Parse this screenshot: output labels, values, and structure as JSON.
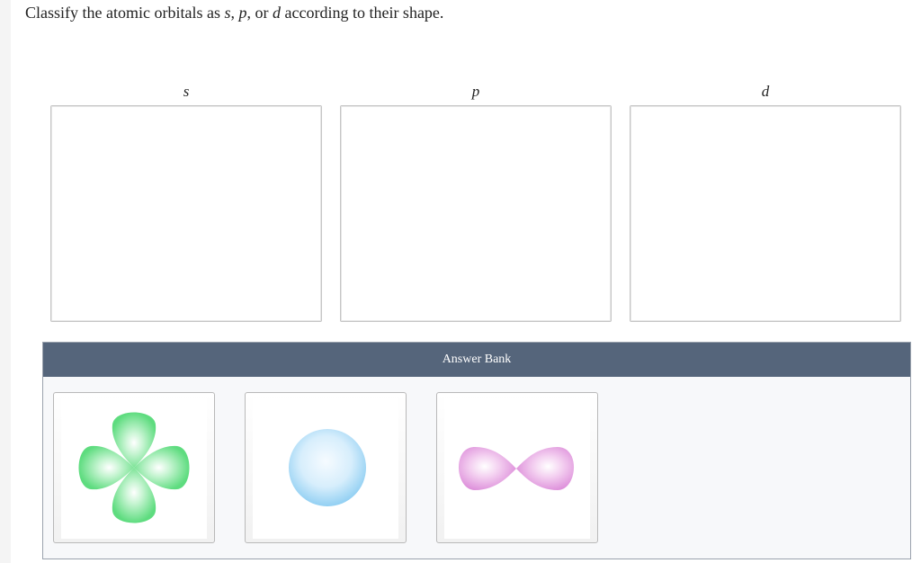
{
  "question": {
    "prefix": "Classify the atomic orbitals as",
    "s": "s",
    "sep1": ",",
    "p": "p",
    "sep2": ", or",
    "d": "d",
    "suffix": "according to their shape."
  },
  "categories": [
    {
      "label": "s"
    },
    {
      "label": "p"
    },
    {
      "label": "d"
    }
  ],
  "answer_bank": {
    "title": "Answer Bank",
    "items": [
      {
        "icon": "d-orbital-cloverleaf-icon",
        "color": "#6fe28c"
      },
      {
        "icon": "s-orbital-sphere-icon",
        "color": "#a9dcf6"
      },
      {
        "icon": "p-orbital-dumbbell-icon",
        "color": "#e29be0"
      }
    ]
  },
  "colors": {
    "bank_header": "#55657b",
    "drop_border": "#c6c6c6"
  }
}
